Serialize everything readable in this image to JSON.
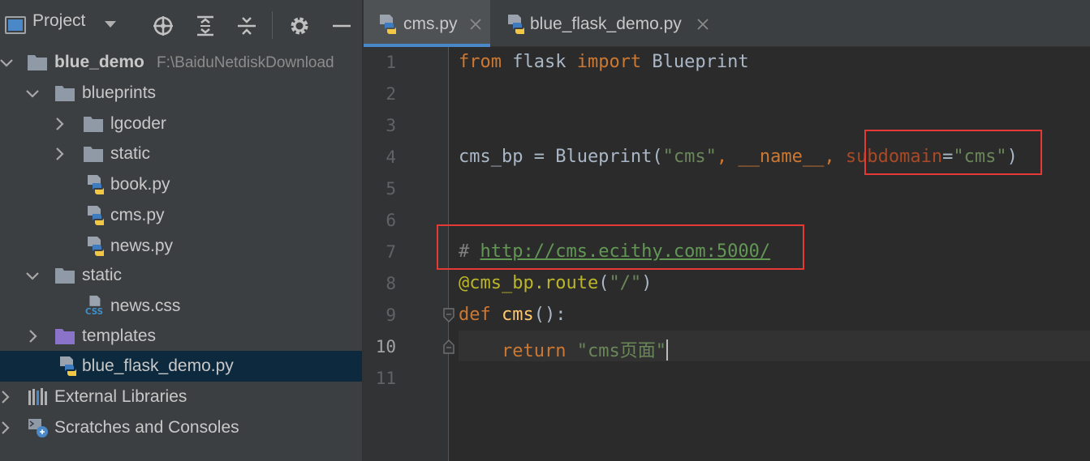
{
  "project_panel": {
    "title": "Project",
    "icons": [
      "panel-icon",
      "dropdown-icon",
      "locate-icon",
      "expand-all-icon",
      "collapse-all-icon",
      "gear-icon",
      "minimize-icon"
    ],
    "tree": [
      {
        "label": "blue_demo",
        "path": "F:\\BaiduNetdiskDownload",
        "type": "folder",
        "expanded": true
      },
      {
        "label": "blueprints",
        "type": "folder",
        "expanded": true
      },
      {
        "label": "lgcoder",
        "type": "folder",
        "expanded": false
      },
      {
        "label": "static",
        "type": "folder",
        "expanded": false
      },
      {
        "label": "book.py",
        "type": "python-file"
      },
      {
        "label": "cms.py",
        "type": "python-file"
      },
      {
        "label": "news.py",
        "type": "python-file"
      },
      {
        "label": "static",
        "type": "folder",
        "expanded": true
      },
      {
        "label": "news.css",
        "type": "css-file",
        "badge": "CSS"
      },
      {
        "label": "templates",
        "type": "templates-folder",
        "expanded": false
      },
      {
        "label": "blue_flask_demo.py",
        "type": "python-file",
        "selected": true
      },
      {
        "label": "External Libraries",
        "type": "libraries"
      },
      {
        "label": "Scratches and Consoles",
        "type": "scratches"
      }
    ]
  },
  "editor": {
    "tabs": [
      {
        "label": "cms.py",
        "active": true
      },
      {
        "label": "blue_flask_demo.py",
        "active": false
      }
    ],
    "line_numbers": [
      "1",
      "2",
      "3",
      "4",
      "5",
      "6",
      "7",
      "8",
      "9",
      "10",
      "11"
    ],
    "current_line": "10",
    "code": {
      "l1": {
        "kw1": "from",
        "t1": " flask ",
        "kw2": "import",
        "t2": " Blueprint"
      },
      "l4": {
        "t1": "cms_bp = Blueprint(",
        "s1": "\"cms\"",
        "t2": ", __name__",
        "k2": ", ",
        "p1": "subdomain",
        "t3": "=",
        "s2": "\"cms\"",
        "t4": ")"
      },
      "l7": {
        "c1": "# ",
        "url": "http://cms.ecithy.com:5000/"
      },
      "l8": {
        "deco": "@cms_bp.route",
        "t1": "(",
        "s1": "\"/\"",
        "t2": ")"
      },
      "l9": {
        "kw": "def",
        "t1": " ",
        "fn": "cms",
        "t2": "():"
      },
      "l10": {
        "indent": "    ",
        "kw": "return",
        "t1": " ",
        "s1": "\"cms页面\""
      }
    }
  },
  "colors": {
    "panel_bg": "#3c3f41",
    "editor_bg": "#2b2b2b",
    "selection": "#0d293e",
    "highlight_border": "#e53935",
    "keyword": "#cc7832",
    "string": "#6a8759"
  }
}
